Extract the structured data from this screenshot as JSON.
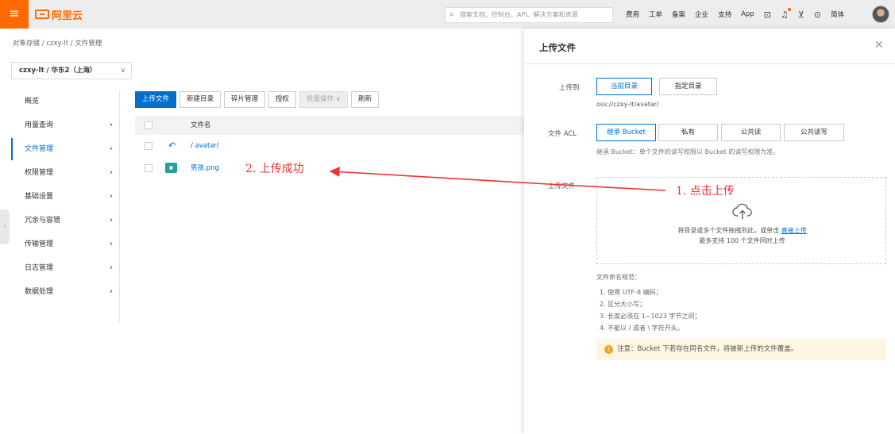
{
  "topbar": {
    "brand": "阿里云",
    "search_placeholder": "搜索文档、控制台、API、解决方案和资源",
    "links": [
      "费用",
      "工单",
      "备案",
      "企业",
      "支持",
      "App"
    ],
    "lang": "简体",
    "colors": {
      "brand": "#ff6a00",
      "primary": "#0070cc",
      "annotation": "#e33333"
    }
  },
  "breadcrumb": "对象存储 / czxy-lt / 文件管理",
  "bucket_select": "czxy-lt / 华东2（上海）",
  "sidebar": {
    "items": [
      {
        "label": "概览",
        "arrow": ""
      },
      {
        "label": "用量查询",
        "arrow": "›"
      },
      {
        "label": "文件管理",
        "arrow": "›",
        "active": true
      },
      {
        "label": "权限管理",
        "arrow": "›"
      },
      {
        "label": "基础设置",
        "arrow": "›"
      },
      {
        "label": "冗余与容错",
        "arrow": "›"
      },
      {
        "label": "传输管理",
        "arrow": "›"
      },
      {
        "label": "日志管理",
        "arrow": "›"
      },
      {
        "label": "数据处理",
        "arrow": "›"
      }
    ]
  },
  "toolbar": {
    "upload": "上传文件",
    "new_dir": "新建目录",
    "fragments": "碎片管理",
    "auth": "授权",
    "batch": "批量操作 ∨",
    "refresh": "刷新"
  },
  "table": {
    "header_name": "文件名",
    "rows": [
      {
        "name": "/ avatar/"
      },
      {
        "name": "男孩.png"
      }
    ]
  },
  "annotations": {
    "step1": "1. 点击上传",
    "step2": "2. 上传成功"
  },
  "panel": {
    "title": "上传文件",
    "upload_to_label": "上传到",
    "upload_to_options": [
      "当前目录",
      "指定目录"
    ],
    "path": "oss://czxy-lt/avatar/",
    "acl_label": "文件 ACL",
    "acl_options": [
      "继承 Bucket",
      "私有",
      "公共读",
      "公共读写"
    ],
    "acl_helper": "继承 Bucket：单个文件的读写权限以 Bucket 的读写权限为准。",
    "file_label": "上传文件",
    "drop_text": "将目录或多个文件拖拽到此，或单击",
    "drop_link": "直接上传",
    "drop_limit": "最多支持 100 个文件同时上传",
    "rules_title": "文件命名规范：",
    "rules": [
      "1. 使用 UTF-8 编码；",
      "2. 区分大小写；",
      "3. 长度必须在 1~1023 字节之间；",
      "4. 不能以 / 或者 \\ 字符开头。"
    ],
    "notice": "注意：Bucket 下若存在同名文件，将被新上传的文件覆盖。"
  }
}
